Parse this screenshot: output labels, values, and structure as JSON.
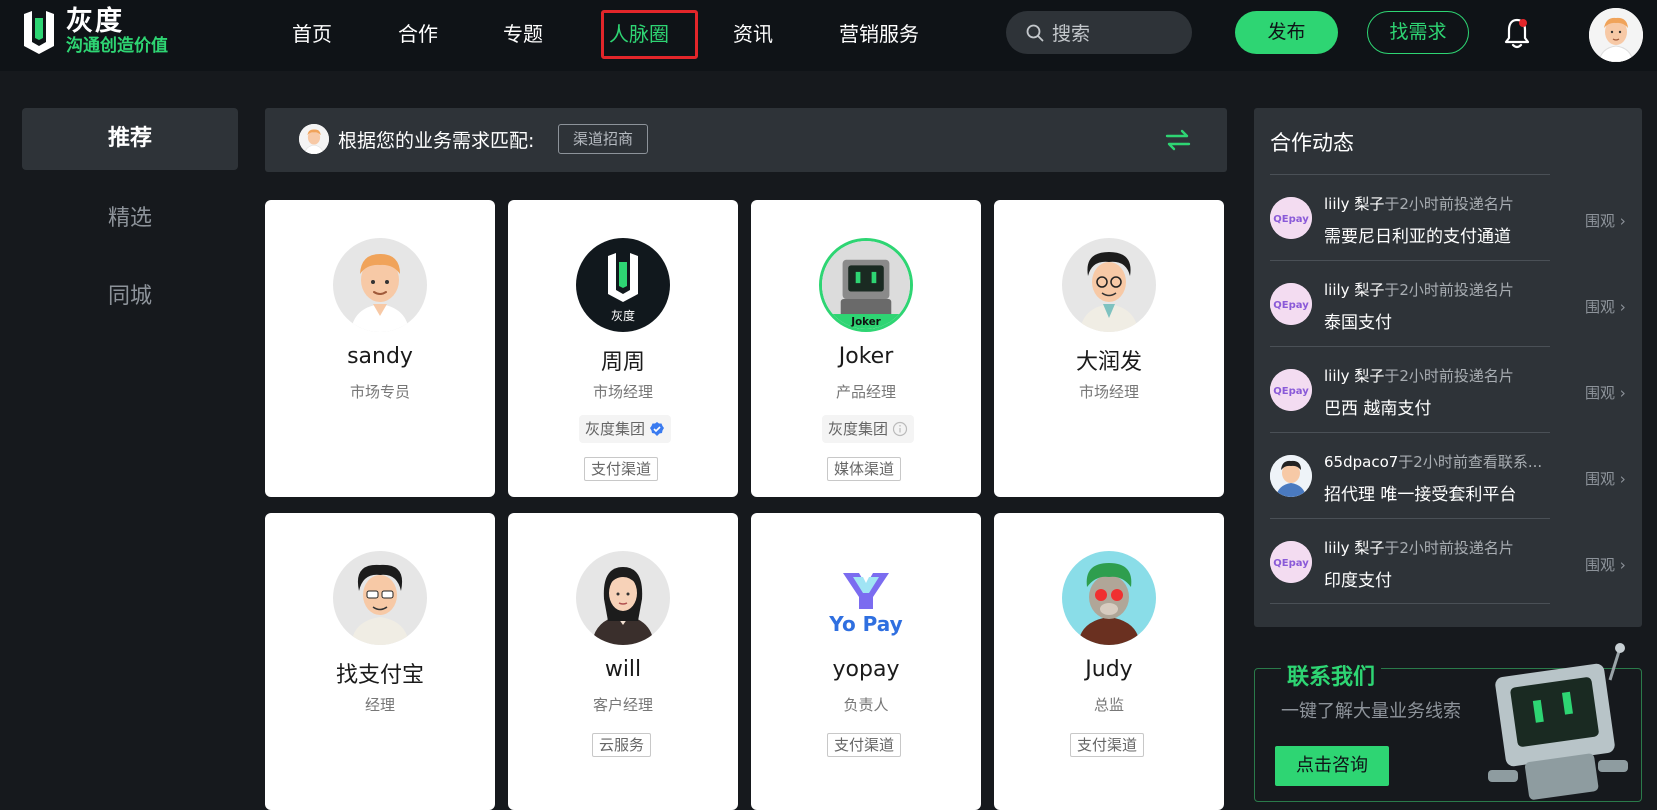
{
  "brand": {
    "name": "灰度",
    "slogan": "沟通创造价值"
  },
  "nav": [
    {
      "label": "首页"
    },
    {
      "label": "合作"
    },
    {
      "label": "专题"
    },
    {
      "label": "人脉圈"
    },
    {
      "label": "资讯"
    },
    {
      "label": "营销服务"
    }
  ],
  "search": {
    "placeholder": "搜索"
  },
  "header": {
    "publish_label": "发布",
    "demand_label": "找需求"
  },
  "sidebar": {
    "items": [
      {
        "label": "推荐"
      },
      {
        "label": "精选"
      },
      {
        "label": "同城"
      }
    ]
  },
  "match": {
    "text": "根据您的业务需求匹配:",
    "tag": "渠道招商"
  },
  "cards": [
    {
      "name": "sandy",
      "role": "市场专员"
    },
    {
      "name": "周周",
      "role": "市场经理",
      "company": "灰度集团",
      "tag": "支付渠道"
    },
    {
      "name": "Joker",
      "role": "产品经理",
      "company": "灰度集团",
      "tag": "媒体渠道"
    },
    {
      "name": "大润发",
      "role": "市场经理"
    },
    {
      "name": "找支付宝",
      "role": "经理"
    },
    {
      "name": "will",
      "role": "客户经理",
      "tag": "云服务"
    },
    {
      "name": "yopay",
      "role": "负责人",
      "tag": "支付渠道"
    },
    {
      "name": "Judy",
      "role": "总监",
      "tag": "支付渠道"
    }
  ],
  "avatar_text": {
    "huidu": "灰度",
    "joker": "Joker",
    "yopay": "Yo Pay",
    "qepay": "QEpay"
  },
  "feed": {
    "title": "合作动态",
    "items": [
      {
        "user": "liily 梨子",
        "action": "于2小时前投递名片",
        "title": "需要尼日利亚的支付通道",
        "watch": "围观"
      },
      {
        "user": "liily 梨子",
        "action": "于2小时前投递名片",
        "title": "泰国支付",
        "watch": "围观"
      },
      {
        "user": "liily 梨子",
        "action": "于2小时前投递名片",
        "title": "巴西 越南支付",
        "watch": "围观"
      },
      {
        "user": "65dpaco7",
        "action": "于2小时前查看联系...",
        "title": "招代理 唯一接受套利平台",
        "watch": "围观"
      },
      {
        "user": "liily 梨子",
        "action": "于2小时前投递名片",
        "title": "印度支付",
        "watch": "围观"
      }
    ]
  },
  "contact": {
    "title": "联系我们",
    "subtitle": "一键了解大量业务线索",
    "button": "点击咨询"
  },
  "colors": {
    "accent": "#2ed573",
    "background": "#16191d",
    "panel": "#2e3338",
    "highlight": "#e3262a"
  }
}
